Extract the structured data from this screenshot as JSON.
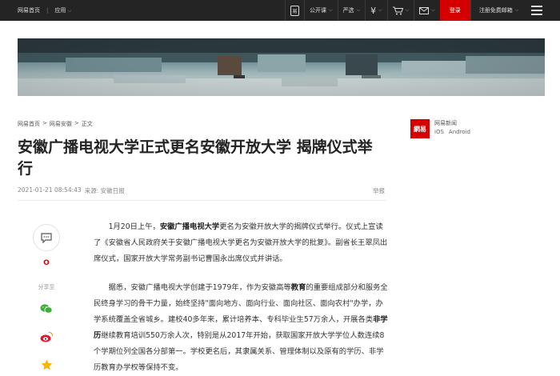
{
  "topbar": {
    "home": "网易首页",
    "apps": "应用",
    "kaola": "易",
    "open_course": "公开课",
    "yanxuan": "严选",
    "pay_icon": "yuan-icon",
    "cart_icon": "cart-icon",
    "mail_icon": "mail-icon",
    "login": "登录",
    "register": "注册免费邮箱"
  },
  "breadcrumb": {
    "item1": "网易首页",
    "sep": ">",
    "item2": "网易安徽",
    "item3": "正文"
  },
  "article": {
    "title": "安徽广播电视大学正式更名安徽开放大学 揭牌仪式举行",
    "datetime": "2021-01-21 08:54:43",
    "source": "来源: 安徽日报",
    "report": "举报",
    "p1_a": "1月20日上午，",
    "p1_b": "安徽广播电视大学",
    "p1_c": "更名为安徽开放大学的揭牌仪式举行。仪式上宣读了《安徽省人民政府关于安徽广播电视大学更名为安徽开放大学的批复》。副省长王翠凤出席仪式，国家开放大学常务副书记曹国永出席仪式并讲话。",
    "p2_a": "据悉，安徽广播电视大学创建于1979年，作为安徽高等",
    "p2_b": "教育",
    "p2_c": "的重要组成部分和服务全民终身学习的骨干力量，始终坚持\"面向地方、面向行业、面向社区、面向农村\"办学，办学系统覆盖全省城乡。建校40多年来，累计培养本、专科毕业生57万余人，开展各类",
    "p2_d": "非学历",
    "p2_e": "继续教育培训550万余人次，特别是从2017年开始，获取国家开放大学学位人数连续8个学期位列全国各分部第一。学校更名后，其隶属关系、管理体制以及原有的学历、非学历教育办学权等保持不变。"
  },
  "side": {
    "share_label": "分享至"
  },
  "app_promo": {
    "logo": "網易",
    "name": "网易新闻",
    "ios": "iOS",
    "android": "Android"
  }
}
